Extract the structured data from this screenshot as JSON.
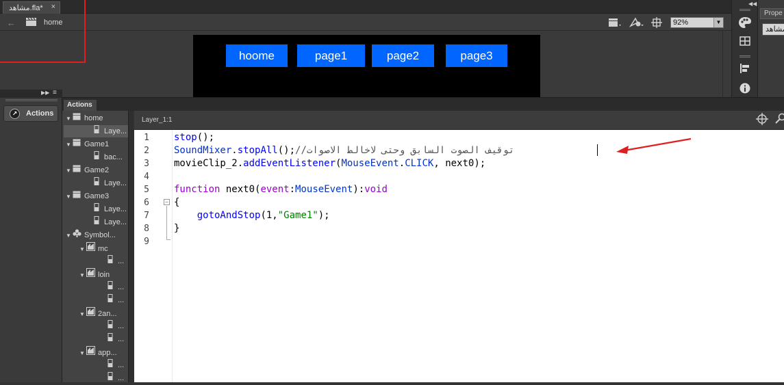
{
  "document": {
    "tab_title": "مشاهد.fla*",
    "close_glyph": "×",
    "breadcrumb_scene": "home",
    "zoom": "92%"
  },
  "stage": {
    "buttons": [
      "hoome",
      "page1",
      "page2",
      "page3"
    ],
    "bg": "#000000",
    "button_color": "#0066ff"
  },
  "properties": {
    "tab": "Prope",
    "field_value": "مشاهد"
  },
  "dock": {
    "actions_button": "Actions"
  },
  "actions_panel": {
    "tab": "Actions",
    "code_title": "Layer_1:1",
    "tree": [
      {
        "label": "home",
        "level": 0,
        "icon": "scene-icon",
        "twisty": "▼"
      },
      {
        "label": "Laye...",
        "level": 1,
        "icon": "layer-icon",
        "twisty": ""
      },
      {
        "label": "Game1",
        "level": 0,
        "icon": "scene-icon",
        "twisty": "▼"
      },
      {
        "label": "bac...",
        "level": 1,
        "icon": "layer-icon",
        "twisty": ""
      },
      {
        "label": "Game2",
        "level": 0,
        "icon": "scene-icon",
        "twisty": "▼"
      },
      {
        "label": "Laye...",
        "level": 1,
        "icon": "layer-icon",
        "twisty": ""
      },
      {
        "label": "Game3",
        "level": 0,
        "icon": "scene-icon",
        "twisty": "▼"
      },
      {
        "label": "Laye...",
        "level": 1,
        "icon": "layer-icon",
        "twisty": ""
      },
      {
        "label": "Laye...",
        "level": 1,
        "icon": "layer-icon",
        "twisty": ""
      },
      {
        "label": "Symbol...",
        "level": 0,
        "icon": "symbol-icon",
        "twisty": "▼"
      },
      {
        "label": "mc",
        "level": 1,
        "icon": "movieclip-icon",
        "twisty": "▼"
      },
      {
        "label": "...",
        "level": 2,
        "icon": "layer-icon",
        "twisty": ""
      },
      {
        "label": "loin",
        "level": 1,
        "icon": "movieclip-icon",
        "twisty": "▼"
      },
      {
        "label": "...",
        "level": 2,
        "icon": "layer-icon",
        "twisty": ""
      },
      {
        "label": "...",
        "level": 2,
        "icon": "layer-icon",
        "twisty": ""
      },
      {
        "label": "2an...",
        "level": 1,
        "icon": "movieclip-icon",
        "twisty": "▼"
      },
      {
        "label": "...",
        "level": 2,
        "icon": "layer-icon",
        "twisty": ""
      },
      {
        "label": "...",
        "level": 2,
        "icon": "layer-icon",
        "twisty": ""
      },
      {
        "label": "app...",
        "level": 1,
        "icon": "movieclip-icon",
        "twisty": "▼"
      },
      {
        "label": "...",
        "level": 2,
        "icon": "layer-icon",
        "twisty": ""
      },
      {
        "label": "...",
        "level": 2,
        "icon": "layer-icon",
        "twisty": ""
      }
    ],
    "line_numbers": [
      "1",
      "2",
      "3",
      "4",
      "5",
      "6",
      "7",
      "8",
      "9"
    ],
    "code": {
      "l1_a": "stop",
      "l1_b": "();",
      "l2_a": "SoundMixer",
      "l2_b": ".",
      "l2_c": "stopAll",
      "l2_d": "();",
      "l2_comment": "//توقيف الصوت السابق وحتى لاخالط الاصوات",
      "l3_a": "movieClip_2.",
      "l3_b": "addEventListener",
      "l3_c": "(",
      "l3_d": "MouseEvent",
      "l3_e": ".",
      "l3_f": "CLICK",
      "l3_g": ", next0);",
      "l5_a": "function",
      "l5_b": " next0(",
      "l5_c": "event",
      "l5_d": ":",
      "l5_e": "MouseEvent",
      "l5_f": "):",
      "l5_g": "void",
      "l6": "{",
      "l7_a": "    ",
      "l7_b": "gotoAndStop",
      "l7_c": "(1,",
      "l7_d": "\"Game1\"",
      "l7_e": ");",
      "l8": "}"
    }
  },
  "colors": {
    "annotation_red": "#e02020"
  }
}
